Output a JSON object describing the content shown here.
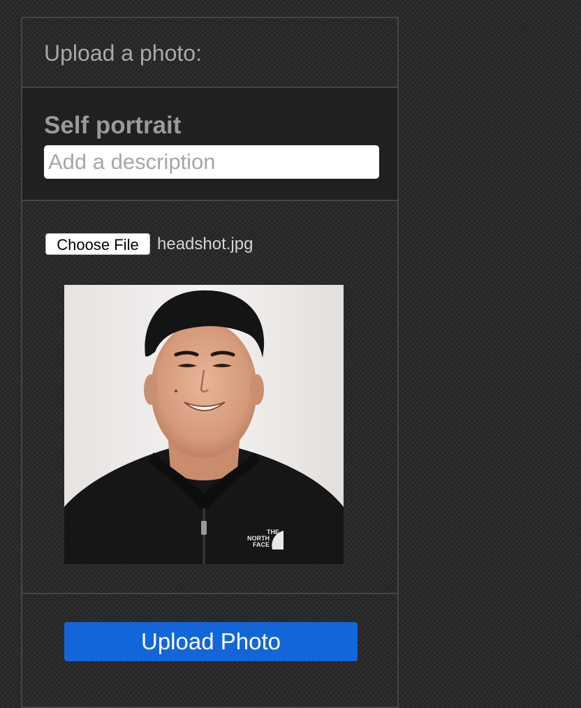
{
  "header": {
    "title": "Upload a photo:"
  },
  "photo": {
    "title": "Self portrait",
    "description_value": "",
    "description_placeholder": "Add a description"
  },
  "file": {
    "choose_label": "Choose File",
    "file_name": "headshot.jpg",
    "shirt_logo_text": "THE NORTH FACE"
  },
  "actions": {
    "upload_label": "Upload Photo"
  },
  "colors": {
    "background": "#2b2b2b",
    "panel_border": "#454545",
    "title_section_bg": "#202020",
    "primary_button": "#1366da"
  }
}
